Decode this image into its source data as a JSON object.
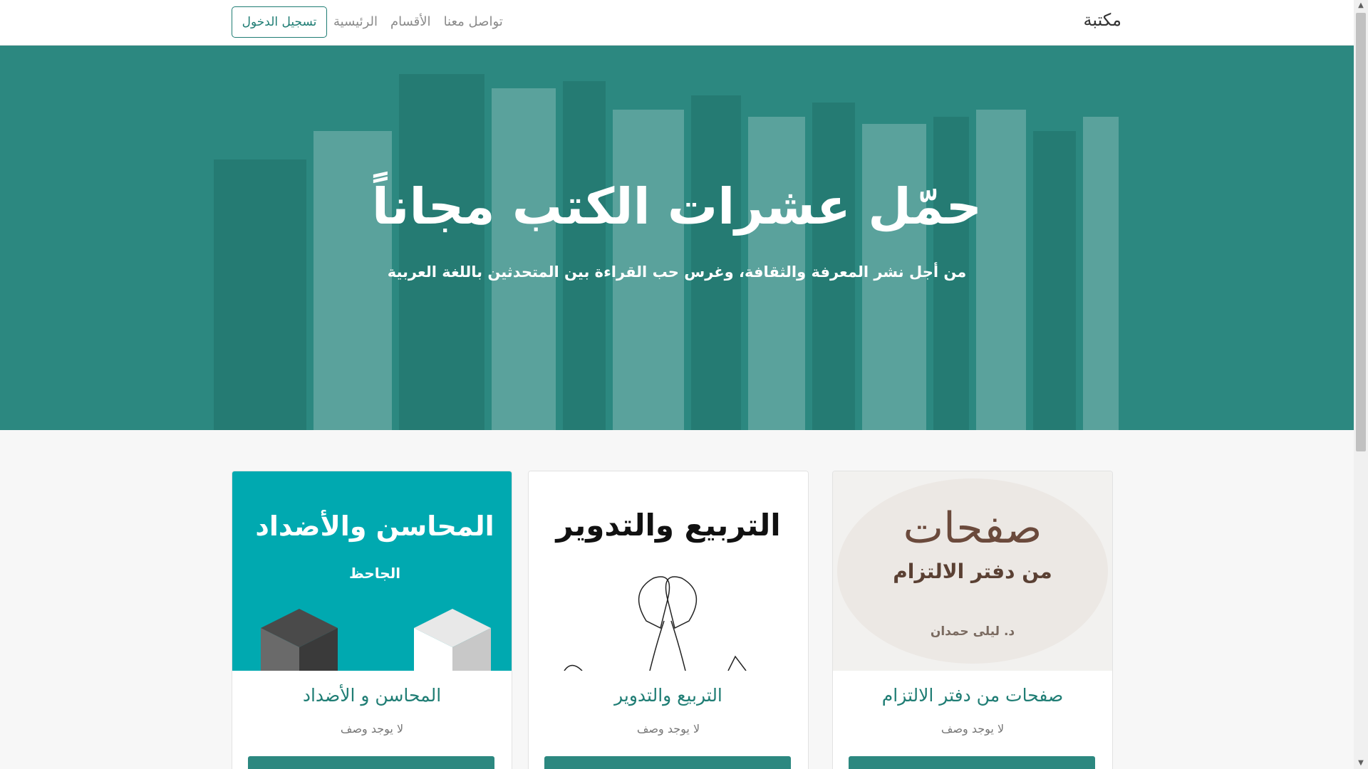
{
  "navbar": {
    "brand": "مكتبة",
    "links": [
      "الرئيسية",
      "الأقسام",
      "تواصل معنا"
    ],
    "login_label": "تسجيل الدخول"
  },
  "hero": {
    "title": "حمّل عشرات الكتب مجاناً",
    "subtitle": "من أجل نشر المعرفة والثقافة، وغرس حب القراءة بين المتحدثين باللغة العربية"
  },
  "cards": [
    {
      "cover_title": "صفحات",
      "cover_subtitle": "من دفتر الالتزام",
      "cover_author": "د. ليلى حمدان",
      "title": "صفحات من دفتر الالتزام",
      "desc": "لا يوجد وصف"
    },
    {
      "cover_title": "التربيع والتدوير",
      "title": "التربيع والتدوير",
      "desc": "لا يوجد وصف"
    },
    {
      "cover_title": "المحاسن والأضداد",
      "cover_author": "الجاحظ",
      "title": "المحاسن و الأضداد",
      "desc": "لا يوجد وصف"
    }
  ],
  "colors": {
    "primary": "#2c8880",
    "primary_dark": "#1f7d74",
    "card3_cover": "#00a9b0"
  }
}
